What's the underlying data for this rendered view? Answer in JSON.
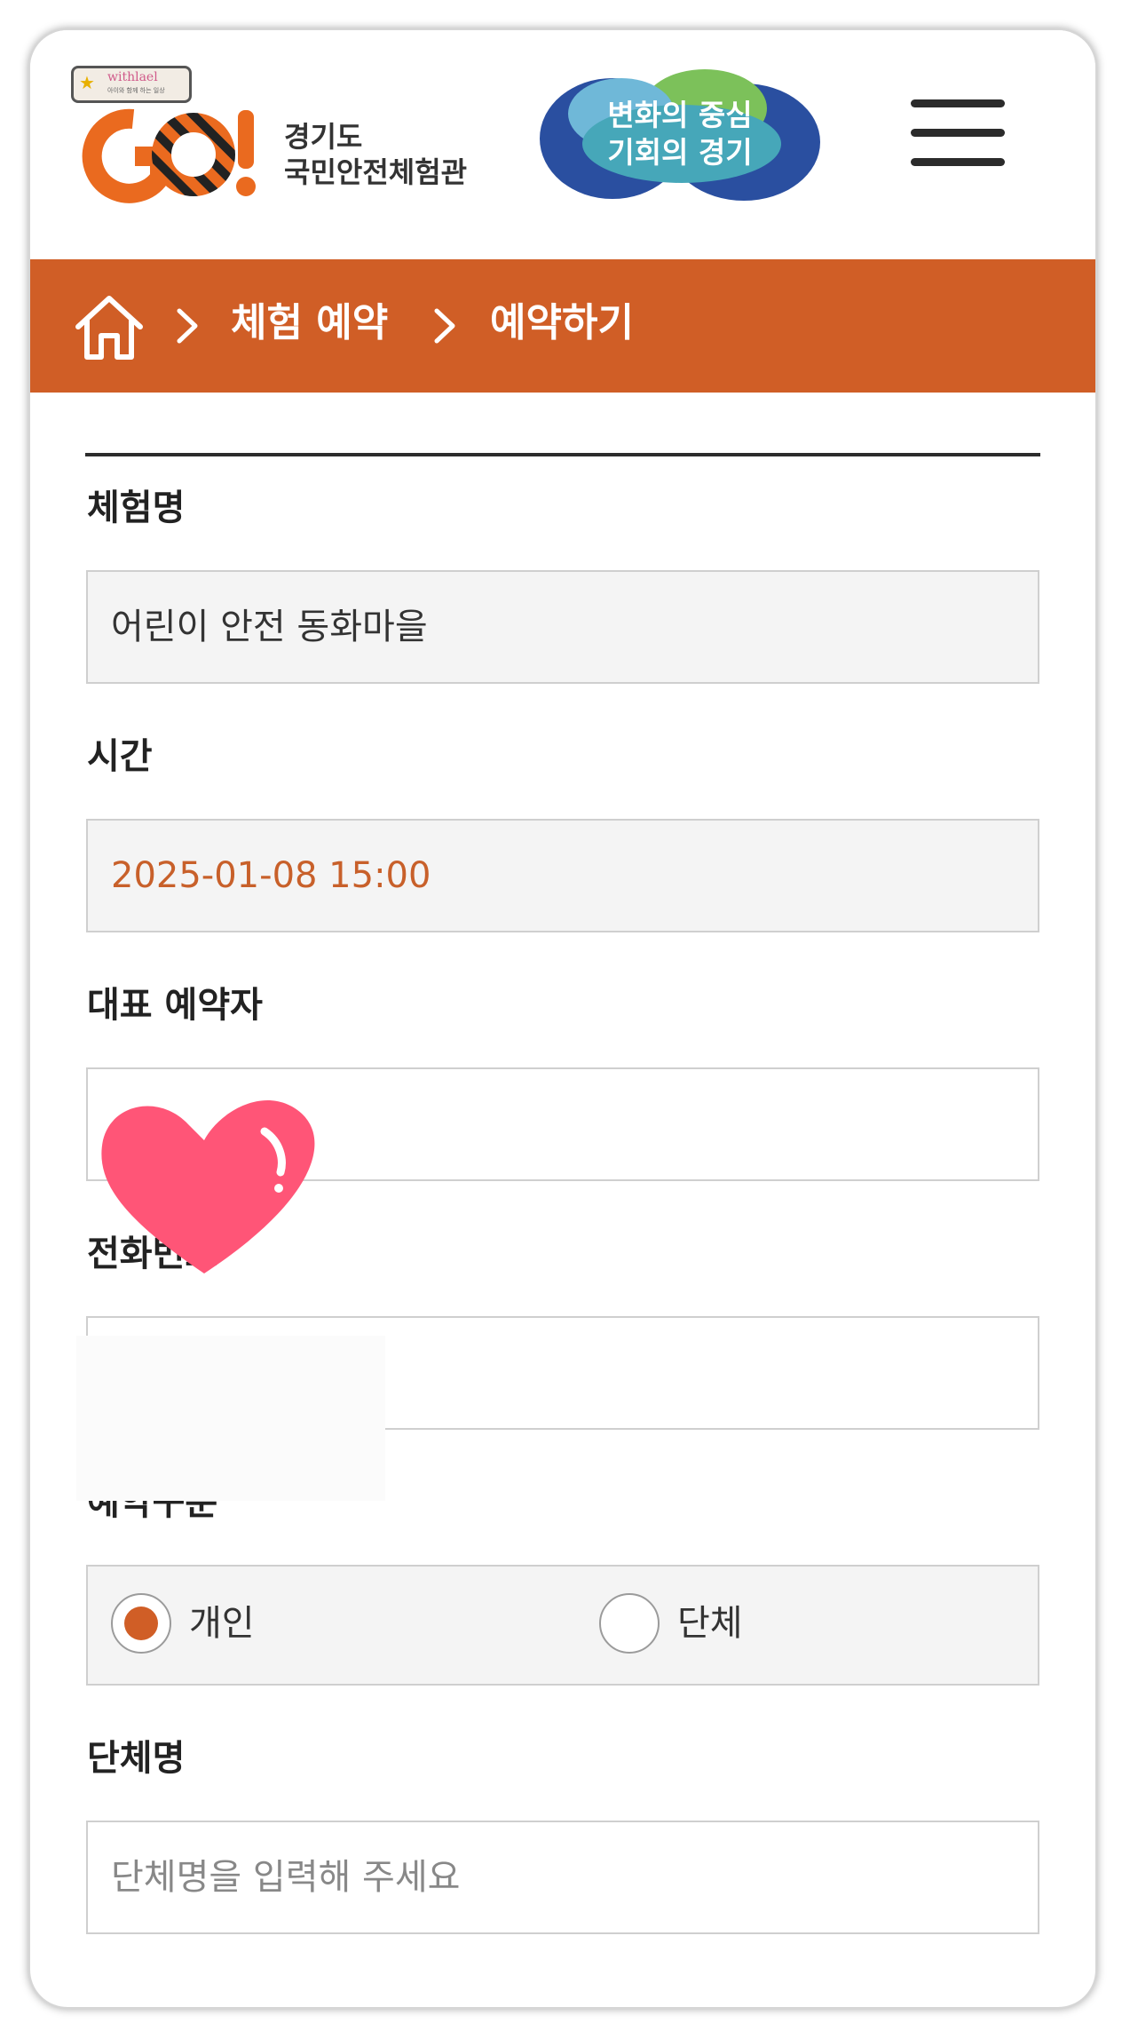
{
  "header": {
    "logo": {
      "mark": "GO!",
      "line1": "경기도",
      "line2": "국민안전체험관"
    },
    "watermark": {
      "name": "withlael",
      "sub": "아이와 함께 하는 일상"
    },
    "slogan": {
      "line1": "변화의 중심",
      "line2": "기회의 경기"
    },
    "menu_icon": "hamburger-icon"
  },
  "breadcrumb": {
    "home_icon": "home-icon",
    "items": [
      "체험 예약",
      "예약하기"
    ],
    "background": "#d05e26"
  },
  "form": {
    "program": {
      "label": "체험명",
      "value": "어린이 안전 동화마을"
    },
    "time": {
      "label": "시간",
      "value": "2025-01-08 15:00"
    },
    "representative": {
      "label": "대표 예약자",
      "value": ""
    },
    "phone": {
      "label": "전화번호",
      "value": ""
    },
    "reservation_type": {
      "label": "예약구분",
      "options": [
        "개인",
        "단체"
      ],
      "selected": "개인"
    },
    "group_name": {
      "label": "단체명",
      "placeholder": "단체명을 입력해 주세요",
      "value": ""
    }
  },
  "colors": {
    "accent": "#d05e26",
    "time_text": "#c8602a",
    "heart": "#ff5577"
  }
}
